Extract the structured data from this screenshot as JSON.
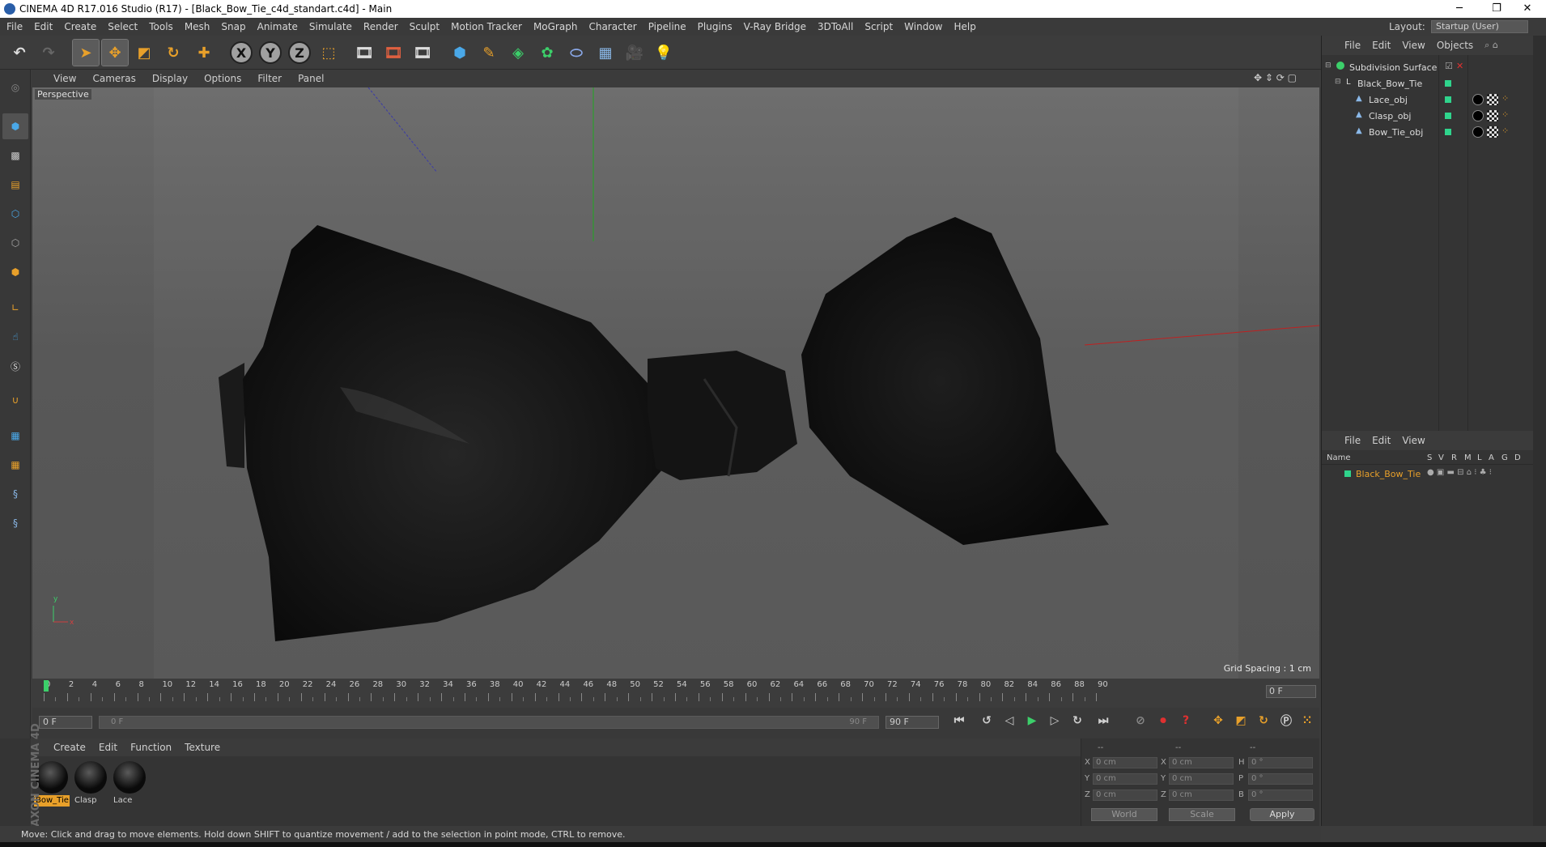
{
  "window": {
    "title": "CINEMA 4D R17.016 Studio (R17) - [Black_Bow_Tie_c4d_standart.c4d] - Main",
    "minimize": "─",
    "restore": "❐",
    "close": "✕"
  },
  "menu": [
    "File",
    "Edit",
    "Create",
    "Select",
    "Tools",
    "Mesh",
    "Snap",
    "Animate",
    "Simulate",
    "Render",
    "Sculpt",
    "Motion Tracker",
    "MoGraph",
    "Character",
    "Pipeline",
    "Plugins",
    "V-Ray Bridge",
    "3DToAll",
    "Script",
    "Window",
    "Help"
  ],
  "layout": {
    "label": "Layout:",
    "value": "Startup (User)"
  },
  "toolbar": {
    "x": "X",
    "y": "Y",
    "z": "Z"
  },
  "viewport": {
    "menu": [
      "View",
      "Cameras",
      "Display",
      "Options",
      "Filter",
      "Panel"
    ],
    "label": "Perspective",
    "grid_spacing": "Grid Spacing : 1 cm",
    "axis_y": "y",
    "axis_x": "x"
  },
  "timeline": {
    "ticks": [
      "0",
      "2",
      "4",
      "6",
      "8",
      "10",
      "12",
      "14",
      "16",
      "18",
      "20",
      "22",
      "24",
      "26",
      "28",
      "30",
      "32",
      "34",
      "36",
      "38",
      "40",
      "42",
      "44",
      "46",
      "48",
      "50",
      "52",
      "54",
      "56",
      "58",
      "60",
      "62",
      "64",
      "66",
      "68",
      "70",
      "72",
      "74",
      "76",
      "78",
      "80",
      "82",
      "84",
      "86",
      "88",
      "90"
    ],
    "current_frame": "0 F",
    "start_frame": "0 F",
    "range_start": "0 F",
    "range_end": "90 F",
    "end_frame": "90 F"
  },
  "materials": {
    "menu": [
      "Create",
      "Edit",
      "Function",
      "Texture"
    ],
    "items": [
      {
        "name": "Bow_Tie"
      },
      {
        "name": "Clasp"
      },
      {
        "name": "Lace"
      }
    ]
  },
  "coordinates": {
    "header": [
      "--",
      "--",
      "--"
    ],
    "rows": [
      {
        "a": "X",
        "av": "0 cm",
        "b": "X",
        "bv": "0 cm",
        "c": "H",
        "cv": "0 °"
      },
      {
        "a": "Y",
        "av": "0 cm",
        "b": "Y",
        "bv": "0 cm",
        "c": "P",
        "cv": "0 °"
      },
      {
        "a": "Z",
        "av": "0 cm",
        "b": "Z",
        "bv": "0 cm",
        "c": "B",
        "cv": "0 °"
      }
    ],
    "mode": "World",
    "transform": "Scale",
    "apply": "Apply"
  },
  "objects": {
    "menu": [
      "File",
      "Edit",
      "View",
      "Objects"
    ],
    "items": [
      {
        "name": "Subdivision Surface"
      },
      {
        "name": "Black_Bow_Tie"
      },
      {
        "name": "Lace_obj"
      },
      {
        "name": "Clasp_obj"
      },
      {
        "name": "Bow_Tie_obj"
      }
    ]
  },
  "attributes": {
    "menu": [
      "File",
      "Edit",
      "View"
    ],
    "columns": [
      "Name",
      "S",
      "V",
      "R",
      "M",
      "L",
      "A",
      "G",
      "D"
    ],
    "layer": "Black_Bow_Tie"
  },
  "status": "Move: Click and drag to move elements. Hold down SHIFT to quantize movement / add to the selection in point mode, CTRL to remove.",
  "branding": "MAXON CINEMA 4D",
  "colors": {
    "accent": "#e8a02a",
    "green": "#2fd48c",
    "background": "#3c3c3c"
  }
}
